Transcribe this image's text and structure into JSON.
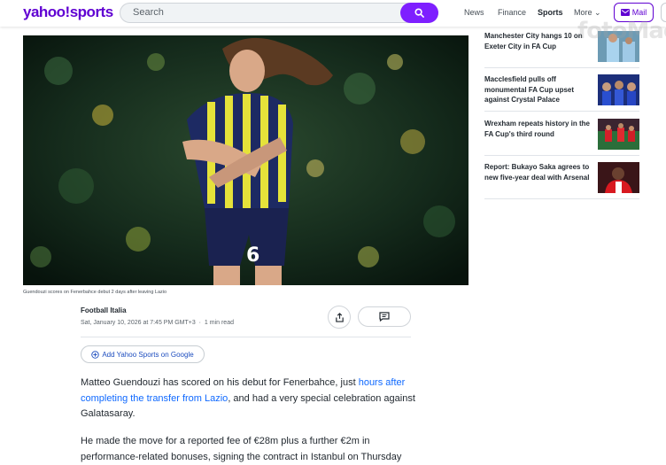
{
  "header": {
    "logo": "yahoo!sports",
    "search_placeholder": "Search",
    "nav": [
      "News",
      "Finance",
      "Sports",
      "More"
    ],
    "more_chevron": "⌄",
    "mail_label": "Mail",
    "brand_color": "#6001d2",
    "search_button_color": "#7e1fff"
  },
  "article": {
    "image_caption": "Guendouzi scores on Fenerbahce debut 2 days after leaving Lazio",
    "author": "Football Italia",
    "date": "Sat, January 10, 2026 at 7:45 PM GMT+3",
    "separator": "·",
    "read_time": "1 min read",
    "google_button": "Add Yahoo Sports on Google",
    "p1_before": "Matteo Guendouzi has scored on his debut for Fenerbahce, just ",
    "p1_link": "hours after completing the transfer from Lazio",
    "p1_after": ", and had a very special celebration against Galatasaray.",
    "p2": "He made the move for a reported fee of €28m plus a further €2m in performance-related bonuses, signing the contract in Istanbul on Thursday"
  },
  "sidebar": {
    "stories": [
      {
        "title": "Manchester City hangs 10 on Exeter City in FA Cup",
        "thumb": "man-city-thumb"
      },
      {
        "title": "Macclesfield pulls off monumental FA Cup upset against Crystal Palace",
        "thumb": "macclesfield-thumb"
      },
      {
        "title": "Wrexham repeats history in the FA Cup's third round",
        "thumb": "wrexham-thumb"
      },
      {
        "title": "Report: Bukayo Saka agrees to new five-year deal with Arsenal",
        "thumb": "saka-thumb"
      }
    ]
  },
  "watermark": "fotoMaç",
  "icons": {
    "search": "search-icon",
    "mail": "mail-icon",
    "share": "share-icon",
    "comment": "comment-icon",
    "add": "plus-circle-icon"
  }
}
